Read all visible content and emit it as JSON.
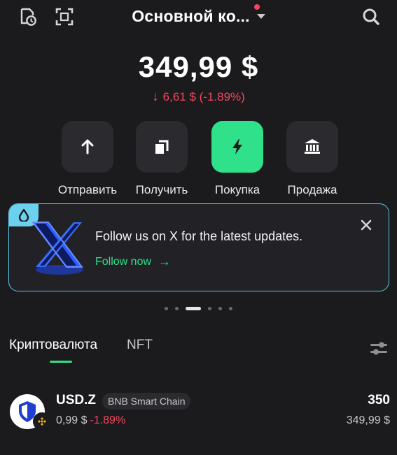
{
  "header": {
    "wallet_name": "Основной ко...",
    "icons": [
      "history-icon",
      "scan-icon",
      "search-icon"
    ]
  },
  "balance": {
    "total": "349,99 $",
    "change": "6,61 $ (-1.89%)",
    "change_color": "#f6465d"
  },
  "actions": [
    {
      "label": "Отправить",
      "icon": "arrow-up-icon"
    },
    {
      "label": "Получить",
      "icon": "copy-icon"
    },
    {
      "label": "Покупка",
      "icon": "lightning-icon"
    },
    {
      "label": "Продажа",
      "icon": "bank-icon"
    }
  ],
  "banner": {
    "text": "Follow us on X for the latest updates.",
    "link": "Follow now",
    "accent": "#2fe18a",
    "border": "#5cc8e6"
  },
  "pager": {
    "count": 6,
    "active": 2
  },
  "tabs": [
    {
      "label": "Криптовалюта",
      "active": true
    },
    {
      "label": "NFT",
      "active": false
    }
  ],
  "assets": [
    {
      "symbol": "USD.Z",
      "chain": "BNB Smart Chain",
      "price": "0,99 $",
      "change": "-1.89%",
      "quantity": "350",
      "value": "349,99 $"
    }
  ]
}
